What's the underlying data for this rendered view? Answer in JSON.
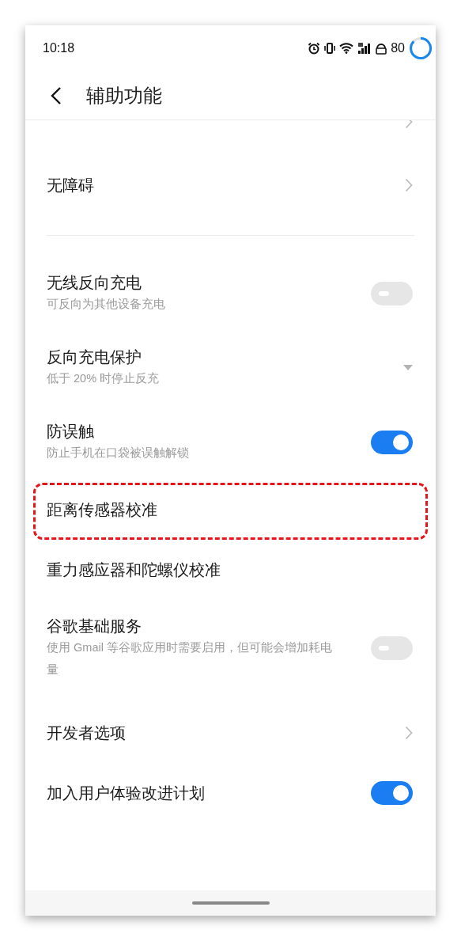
{
  "status_bar": {
    "time": "10:18",
    "battery": "80"
  },
  "header": {
    "title": "辅助功能"
  },
  "groups": [
    [
      {
        "kind": "nav",
        "clipped": true
      },
      {
        "kind": "nav",
        "title": "无障碍"
      }
    ],
    [
      {
        "kind": "toggle",
        "title": "无线反向充电",
        "subtitle": "可反向为其他设备充电",
        "on": false
      },
      {
        "kind": "dropdown",
        "title": "反向充电保护",
        "subtitle": "低于 20% 时停止反充"
      },
      {
        "kind": "toggle",
        "title": "防误触",
        "subtitle": "防止手机在口袋被误触解锁",
        "on": true
      },
      {
        "kind": "plain",
        "title": "距离传感器校准",
        "highlighted": true
      },
      {
        "kind": "plain",
        "title": "重力感应器和陀螺仪校准"
      },
      {
        "kind": "toggle",
        "title": "谷歌基础服务",
        "subtitle": "使用 Gmail 等谷歌应用时需要启用，但可能会增加耗电量",
        "on": false
      },
      {
        "kind": "nav",
        "title": "开发者选项"
      },
      {
        "kind": "toggle",
        "title": "加入用户体验改进计划",
        "on": true
      }
    ]
  ]
}
